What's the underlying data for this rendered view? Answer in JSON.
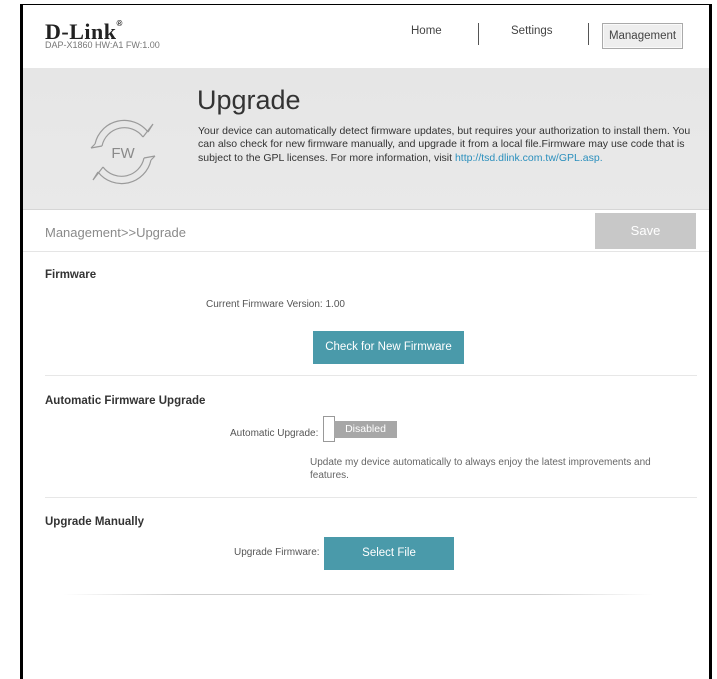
{
  "header": {
    "logo_text": "D-Link",
    "logo_mark": "®",
    "model_info": "DAP-X1860 HW:A1 FW:1.00",
    "nav": {
      "home": "Home",
      "settings": "Settings",
      "management": "Management"
    }
  },
  "banner": {
    "title": "Upgrade",
    "icon_label": "FW",
    "icon": "refresh-cycle-icon",
    "description": "Your device can automatically detect firmware updates, but requires your authorization to install them. You can also check for new firmware manually, and upgrade it from a local file.Firmware may use code that is subject to the GPL licenses. For more information, visit ",
    "link_text": "http://tsd.dlink.com.tw/GPL.asp."
  },
  "breadcrumb": {
    "text": "Management>>Upgrade",
    "save_label": "Save"
  },
  "firmware": {
    "title": "Firmware",
    "current_version_label": "Current Firmware Version:",
    "current_version": "1.00",
    "check_button": "Check for New Firmware"
  },
  "auto_upgrade": {
    "title": "Automatic Firmware Upgrade",
    "label": "Automatic Upgrade:",
    "state": "Disabled",
    "note": "Update my device automatically to always enjoy the latest improvements and features."
  },
  "manual_upgrade": {
    "title": "Upgrade Manually",
    "label": "Upgrade Firmware:",
    "select_button": "Select File"
  },
  "colors": {
    "accent": "#4a9aaa",
    "link": "#2a8fbd",
    "disabled_button": "#c8c8c8",
    "toggle_off": "#a7a7a7"
  }
}
